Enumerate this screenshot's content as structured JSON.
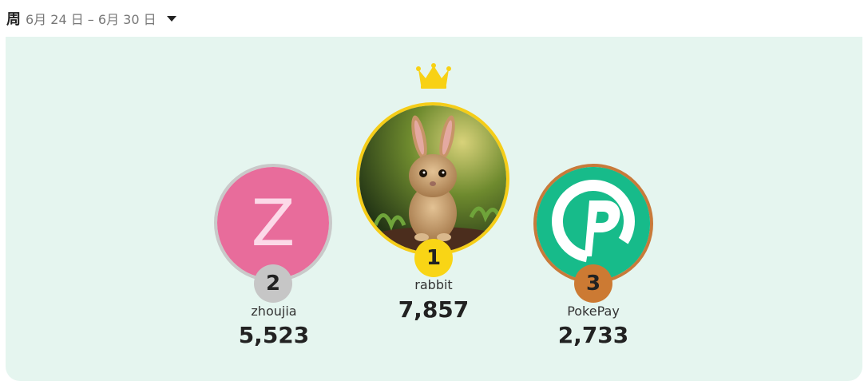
{
  "period": {
    "label": "周",
    "range": "6月 24 日 – 6月 30 日",
    "dropdown_icon": "caret-down-icon"
  },
  "leaderboard": [
    {
      "rank": "2",
      "name": "zhoujia",
      "score": "5,523",
      "avatar_initial": "Z",
      "avatar_color": "#e86c9b",
      "ring_color": "#c9c9c9"
    },
    {
      "rank": "1",
      "name": "rabbit",
      "score": "7,857",
      "avatar_icon": "rabbit-photo",
      "ring_color": "#f5cd18"
    },
    {
      "rank": "3",
      "name": "PokePay",
      "score": "2,733",
      "avatar_icon": "pokepay-logo",
      "avatar_color": "#17bb8a",
      "ring_color": "#c87a3a"
    }
  ],
  "colors": {
    "board_bg": "#e5f5ef",
    "gold": "#f9d515",
    "silver": "#c6c6c6",
    "bronze": "#cc7a33"
  }
}
